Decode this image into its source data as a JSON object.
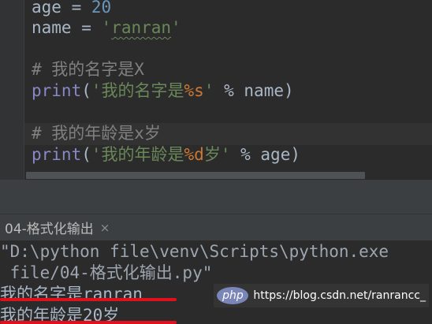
{
  "editor": {
    "lines": [
      {
        "tokens": [
          {
            "t": "age = ",
            "c": ""
          },
          {
            "t": "20",
            "c": "num"
          }
        ]
      },
      {
        "tokens": [
          {
            "t": "name = ",
            "c": ""
          },
          {
            "t": "'",
            "c": "str"
          },
          {
            "t": "ranran",
            "c": "str squiggle"
          },
          {
            "t": "'",
            "c": "str"
          }
        ]
      },
      {
        "tokens": [
          {
            "t": "",
            "c": ""
          }
        ]
      },
      {
        "tokens": [
          {
            "t": "# 我的名字是X",
            "c": "cmt"
          }
        ]
      },
      {
        "tokens": [
          {
            "t": "print",
            "c": "kw"
          },
          {
            "t": "(",
            "c": ""
          },
          {
            "t": "'我的名字是",
            "c": "str"
          },
          {
            "t": "%s",
            "c": "fmt"
          },
          {
            "t": "'",
            "c": "str"
          },
          {
            "t": " % name)",
            "c": ""
          }
        ]
      },
      {
        "tokens": [
          {
            "t": "",
            "c": ""
          }
        ]
      },
      {
        "tokens": [
          {
            "t": "# 我的年龄是x岁",
            "c": "cmt"
          }
        ]
      },
      {
        "tokens": [
          {
            "t": "print",
            "c": "kw"
          },
          {
            "t": "(",
            "c": ""
          },
          {
            "t": "'我的年龄是",
            "c": "str"
          },
          {
            "t": "%d",
            "c": "fmt"
          },
          {
            "t": "岁'",
            "c": "str"
          },
          {
            "t": " % age)",
            "c": ""
          }
        ]
      }
    ]
  },
  "run_panel": {
    "tab_label": "04-格式化输出",
    "close_glyph": "×",
    "console_lines": [
      "\"D:\\python file\\venv\\Scripts\\python.exe",
      " file/04-格式化输出.py\"",
      "我的名字是ranran",
      "我的年龄是20岁"
    ]
  },
  "watermark": {
    "logo_text": "php",
    "url": "https://blog.csdn.net/ranrancc_"
  },
  "colors": {
    "background": "#2b2b2b",
    "keyword": "#8888c6",
    "string": "#6a8759",
    "number": "#6897bb",
    "comment": "#808080",
    "format_spec": "#cc7832",
    "highlight_underline": "#e0101c"
  }
}
